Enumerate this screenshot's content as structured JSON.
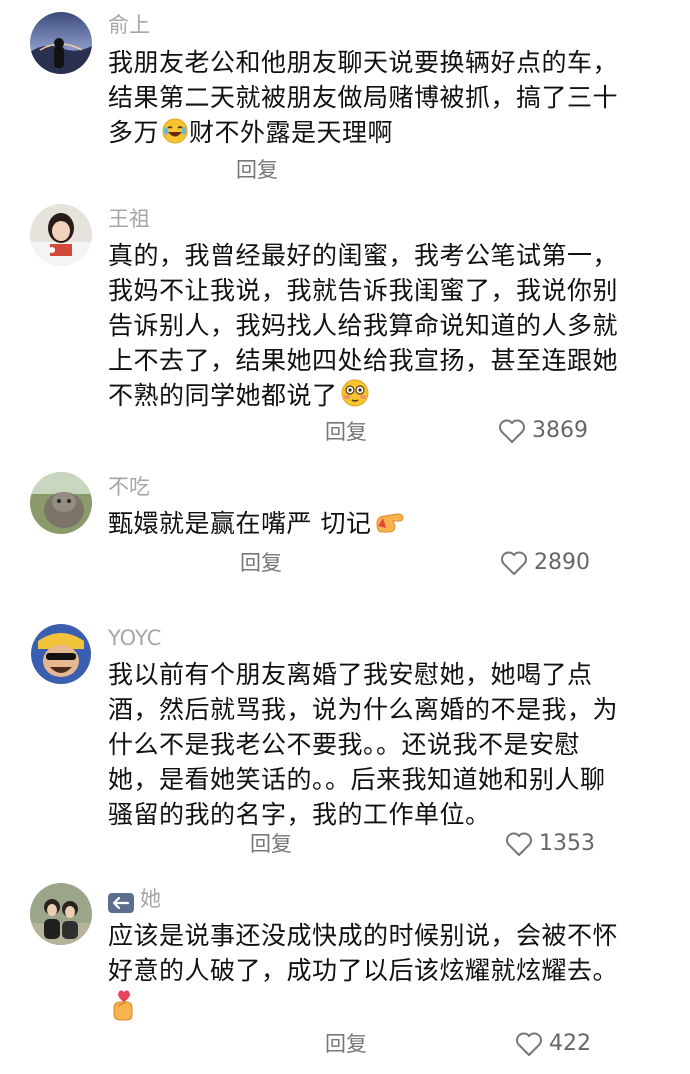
{
  "comments": [
    {
      "username": "俞上",
      "lines": [
        "我朋友老公和他朋友聊天说要换辆好点的车，",
        "结果第二天就被朋友做局赌博被抓，搞了三十",
        "多万",
        "财不外露是天理啊"
      ],
      "emoji": "rofl-emoji",
      "reply": "回复",
      "likes": ""
    },
    {
      "username": "王祖",
      "lines": [
        "真的，我曾经最好的闺蜜，我考公笔试第一，",
        "我妈不让我说，我就告诉我闺蜜了，我说你别",
        "告诉别人，我妈找人给我算命说知道的人多就",
        "上不去了，结果她四处给我宣扬，甚至连跟她",
        "不熟的同学她都说了"
      ],
      "emoji": "flushed-emoji",
      "reply": "回复",
      "likes": "3869"
    },
    {
      "username": "不吃",
      "lines": [
        "甄嬛就是赢在嘴严 切记"
      ],
      "emoji": "pointing-hand-emoji",
      "reply": "回复",
      "likes": "2890"
    },
    {
      "username": "YOYC",
      "lines": [
        "我以前有个朋友离婚了我安慰她，她喝了点",
        "酒，然后就骂我，说为什么离婚的不是我，为",
        "什么不是我老公不要我。。还说我不是安慰",
        "她，是看她笑话的。。后来我知道她和别人聊",
        "骚留的我的名字，我的工作单位。"
      ],
      "emoji": "",
      "reply": "回复",
      "likes": "1353"
    },
    {
      "username": "她",
      "lines": [
        "应该是说事还没成快成的时候别说，会被不怀",
        "好意的人破了，成功了以后该炫耀就炫耀去。"
      ],
      "emoji": "finger-heart-emoji",
      "reply": "回复",
      "likes": "422"
    }
  ],
  "icons": {
    "like": "heart-outline-icon",
    "back": "back-arrow-icon"
  },
  "colors": {
    "username": "#a6a6a6",
    "text": "#111111",
    "reply": "#777777",
    "count": "#666666"
  }
}
